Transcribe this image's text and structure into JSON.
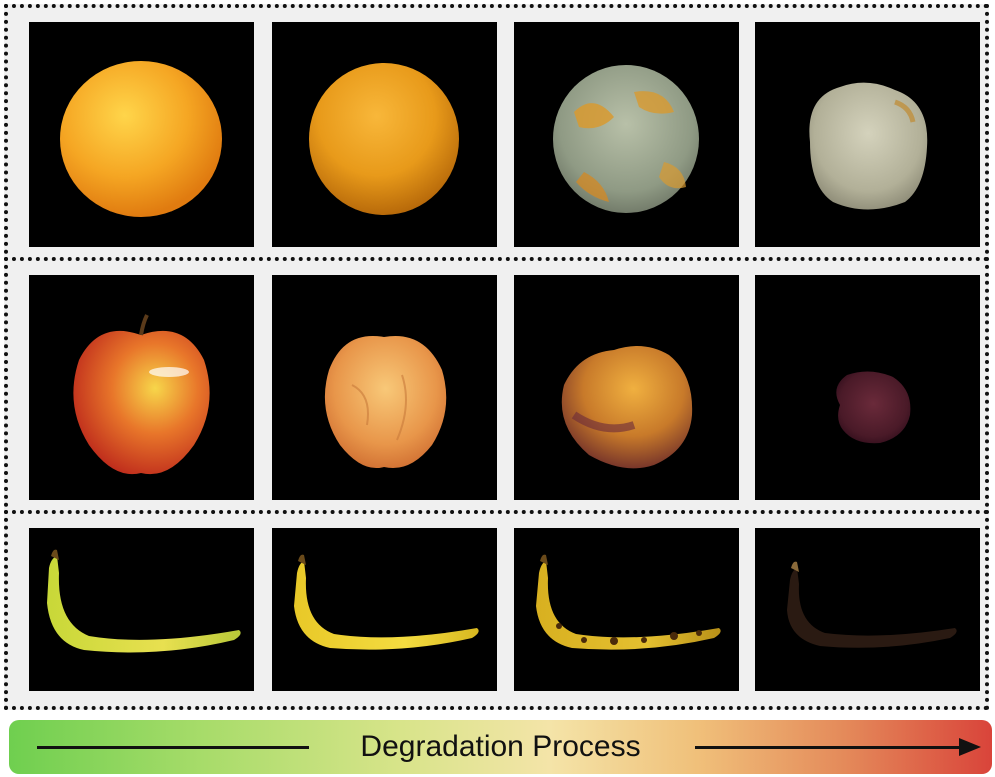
{
  "figure": {
    "rows": [
      {
        "name": "orange",
        "stages": [
          "fresh orange",
          "aging orange",
          "molding orange",
          "fully molded orange"
        ]
      },
      {
        "name": "apple",
        "stages": [
          "fresh apple",
          "wrinkled apple",
          "rotting apple",
          "shriveled apple"
        ]
      },
      {
        "name": "banana",
        "stages": [
          "fresh banana",
          "ripe banana",
          "spotted banana",
          "blackened banana"
        ]
      }
    ],
    "process_label": "Degradation Process",
    "colors": {
      "gradient_start": "#6fcf4f",
      "gradient_mid": "#f4e4a8",
      "gradient_end": "#d9443a"
    }
  }
}
